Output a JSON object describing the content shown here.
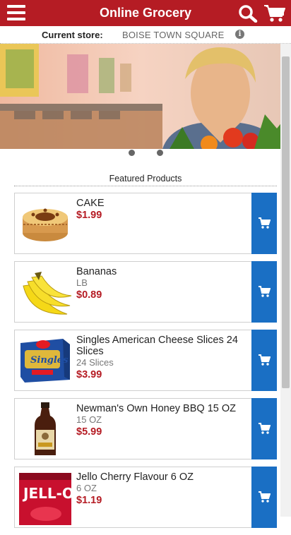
{
  "header": {
    "title": "Online Grocery",
    "menu_icon": "hamburger-menu-icon",
    "search_icon": "search-icon",
    "cart_icon": "shopping-cart-icon"
  },
  "store": {
    "label": "Current store:",
    "name": "BOISE TOWN SQUARE",
    "info_icon": "info-icon"
  },
  "banner": {
    "slides": 2,
    "active_slide": 1
  },
  "featured": {
    "title": "Featured Products"
  },
  "products": [
    {
      "name": "CAKE",
      "sub": "",
      "price": "$1.99"
    },
    {
      "name": "Bananas",
      "sub": "LB",
      "price": "$0.89"
    },
    {
      "name": "Singles American Cheese Slices 24 Slices",
      "sub": "24 Slices",
      "price": "$3.99"
    },
    {
      "name": "Newman's Own Honey BBQ 15 OZ",
      "sub": "15 OZ",
      "price": "$5.99"
    },
    {
      "name": "Jello Cherry Flavour 6 OZ",
      "sub": "6 OZ",
      "price": "$1.19"
    }
  ],
  "colors": {
    "header": "#b51c24",
    "price": "#b51c24",
    "add_button": "#1a6fc4"
  }
}
